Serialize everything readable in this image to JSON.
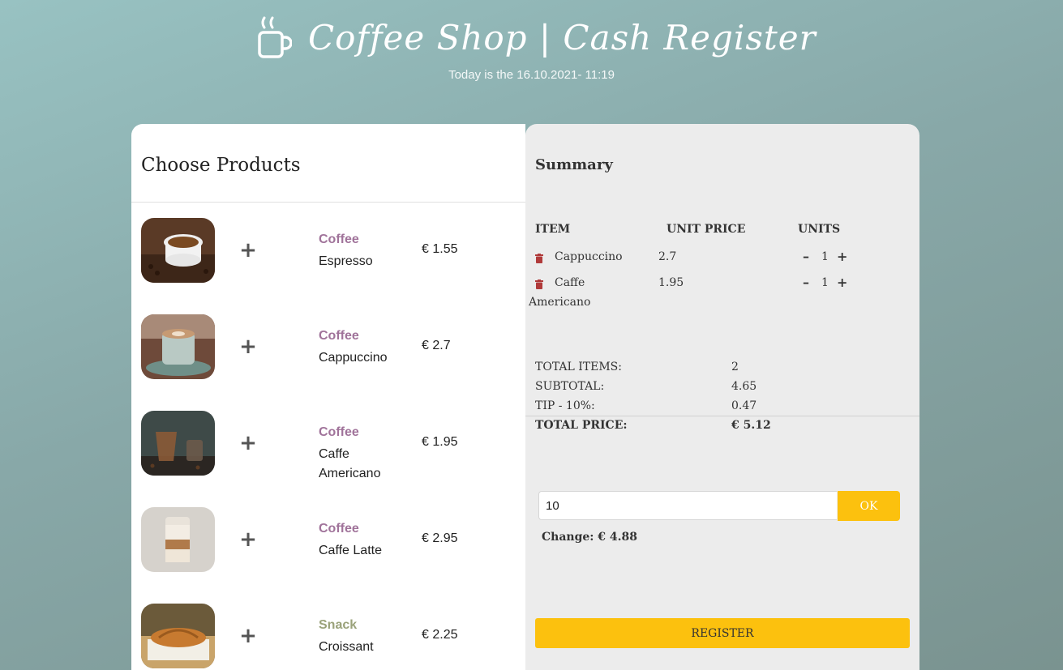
{
  "header": {
    "title": "Coffee Shop | Cash Register",
    "date_line": "Today is the 16.10.2021- 11:19"
  },
  "products_panel": {
    "title": "Choose Products",
    "add_icon": "+",
    "items": [
      {
        "category": "Coffee",
        "name": "Espresso",
        "price": "€ 1.55",
        "image": "espresso-photo"
      },
      {
        "category": "Coffee",
        "name": "Cappuccino",
        "price": "€ 2.7",
        "image": "cappuccino-photo"
      },
      {
        "category": "Coffee",
        "name": "Caffe Americano",
        "price": "€ 1.95",
        "image": "americano-photo"
      },
      {
        "category": "Coffee",
        "name": "Caffe Latte",
        "price": "€ 2.95",
        "image": "latte-photo"
      },
      {
        "category": "Snack",
        "name": "Croissant",
        "price": "€ 2.25",
        "image": "croissant-photo"
      }
    ]
  },
  "summary": {
    "title": "Summary",
    "columns": {
      "item": "ITEM",
      "unit_price": "UNIT PRICE",
      "units": "UNITS"
    },
    "rows": [
      {
        "item": "Cappuccino",
        "unit_price": "2.7",
        "units": "1"
      },
      {
        "item_line1": "Caffe",
        "item_line2": "Americano",
        "unit_price": "1.95",
        "units": "1"
      }
    ],
    "minus": "–",
    "plus": "+",
    "totals": {
      "total_items_label": "TOTAL ITEMS:",
      "total_items": "2",
      "subtotal_label": "SUBTOTAL:",
      "subtotal": "4.65",
      "tip_label": "TIP - 10%:",
      "tip": "0.47",
      "total_price_label": "TOTAL PRICE:",
      "total_price": "€ 5.12"
    },
    "cash_input_value": "10",
    "ok_label": "OK",
    "change_text": "Change: € 4.88",
    "register_label": "REGISTER"
  },
  "colors": {
    "coffee_category": "#a0739a",
    "snack_category": "#9aa27a",
    "accent_yellow": "#fcc10e",
    "trash_red": "#b03a3a"
  },
  "icons": [
    "coffee-cup-icon",
    "plus-icon",
    "trash-icon",
    "minus-icon"
  ]
}
